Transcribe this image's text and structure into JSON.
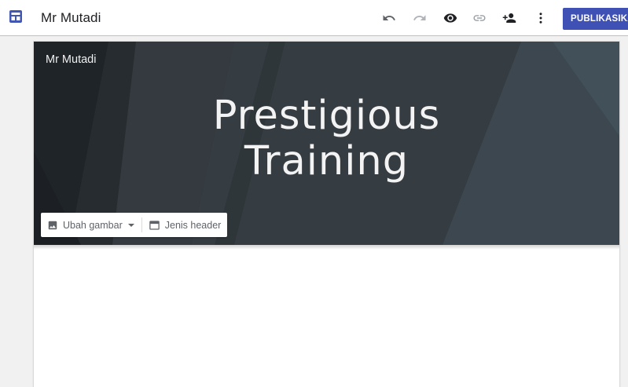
{
  "toolbar": {
    "title": "Mr Mutadi",
    "app_icon": "sites-layout-icon",
    "undo_icon": "undo-icon",
    "redo_icon": "redo-icon",
    "preview_icon": "eye-icon",
    "link_icon": "link-icon",
    "share_icon": "add-person-icon",
    "more_icon": "more-vert-icon",
    "publish_label": "PUBLIKASIKAN",
    "accent_color": "#3f51b5"
  },
  "page": {
    "site_name": "Mr Mutadi",
    "hero_title_line1": "Prestigious",
    "hero_title_line2": "Training",
    "header_tools": {
      "change_image_label": "Ubah gambar",
      "header_type_label": "Jenis header"
    }
  }
}
